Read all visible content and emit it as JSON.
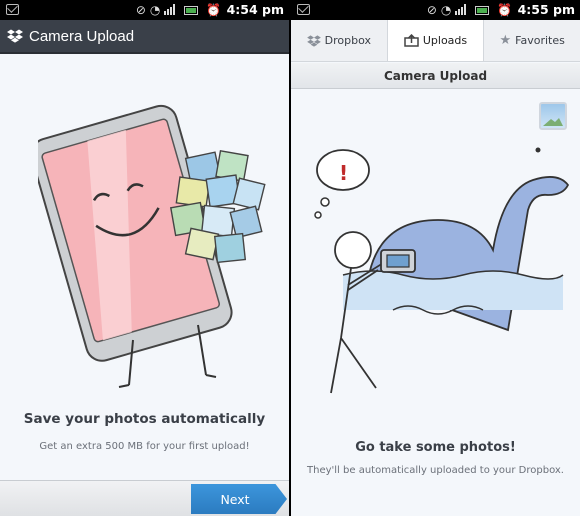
{
  "left": {
    "status_time": "4:54 pm",
    "header_title": "Camera Upload",
    "headline": "Save your photos automatically",
    "subtext": "Get an extra 500 MB for your first upload!",
    "next_label": "Next"
  },
  "right": {
    "status_time": "4:55 pm",
    "tabs": [
      {
        "label": "Dropbox",
        "icon": "dropbox-icon",
        "active": false
      },
      {
        "label": "Uploads",
        "icon": "upload-icon",
        "active": true
      },
      {
        "label": "Favorites",
        "icon": "star-icon",
        "active": false
      }
    ],
    "subheader": "Camera Upload",
    "headline": "Go take some photos!",
    "subtext": "They'll be automatically uploaded to your Dropbox."
  },
  "colors": {
    "action_bar": "#3a4049",
    "accent_blue": "#2b7bc0",
    "background": "#f4f7fb"
  }
}
